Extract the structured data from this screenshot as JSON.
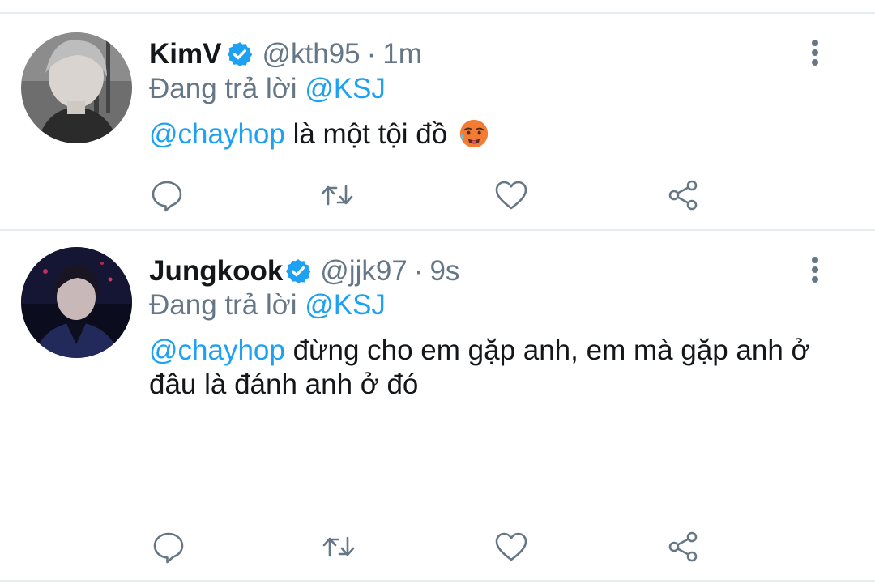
{
  "tweets": [
    {
      "display_name": "KimV",
      "handle": "@kth95",
      "separator": "·",
      "time": "1m",
      "reply_prefix": "Đang trả lời ",
      "reply_to": "@KSJ",
      "body_mention": "@chayhop",
      "body_text": " là một tội đồ",
      "emoji": "hot-face-emoji"
    },
    {
      "display_name": "Jungkook",
      "handle": "@jjk97",
      "separator": "·",
      "time": "9s",
      "reply_prefix": "Đang trả lời ",
      "reply_to": "@KSJ",
      "body_mention": "@chayhop",
      "body_text": " đừng cho em gặp anh, em mà gặp anh ở đâu là đánh anh ở đó"
    }
  ],
  "icons": {
    "verified": "verified-badge-icon",
    "more": "more-vertical-icon",
    "reply": "reply-icon",
    "retweet": "retweet-icon",
    "like": "like-icon",
    "share": "share-icon"
  },
  "colors": {
    "mention": "#1da1f2",
    "secondary_text": "#657786",
    "primary_text": "#14171a",
    "divider": "#e7ecf0",
    "verified": "#1da1f2"
  }
}
